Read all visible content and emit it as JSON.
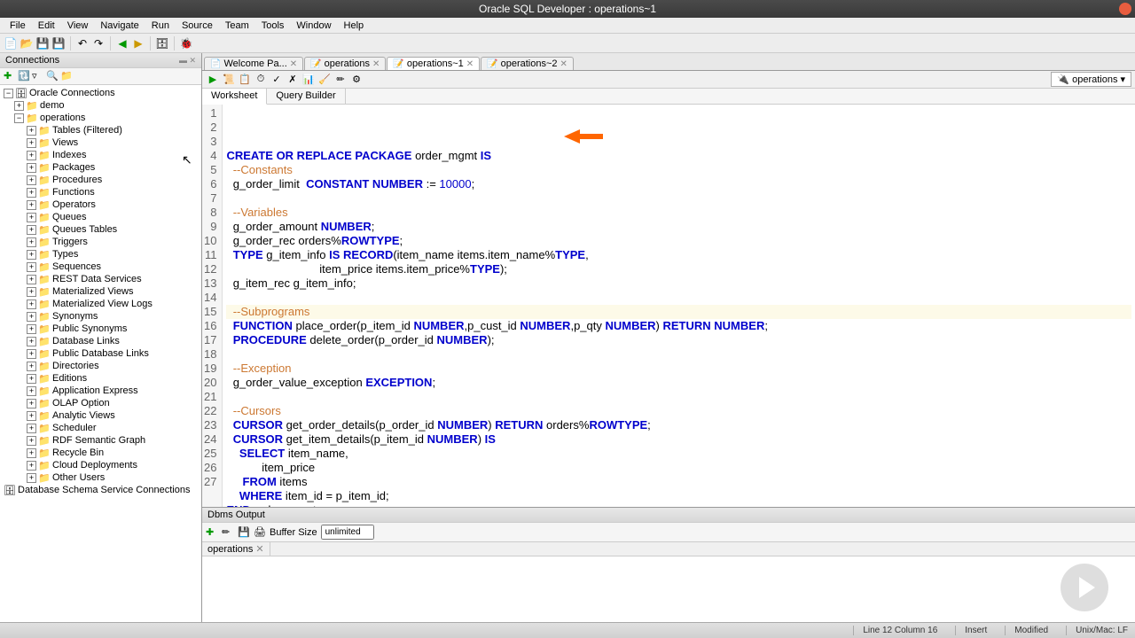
{
  "titlebar": {
    "text": "Oracle SQL Developer : operations~1"
  },
  "menubar": [
    "File",
    "Edit",
    "View",
    "Navigate",
    "Run",
    "Source",
    "Team",
    "Tools",
    "Window",
    "Help"
  ],
  "sidebar": {
    "title": "Connections",
    "root": "Oracle Connections",
    "nodes": [
      {
        "label": "demo",
        "lvl": 1,
        "exp": "+"
      },
      {
        "label": "operations",
        "lvl": 1,
        "exp": "−"
      },
      {
        "label": "Tables (Filtered)",
        "lvl": 2,
        "exp": "+"
      },
      {
        "label": "Views",
        "lvl": 2,
        "exp": "+"
      },
      {
        "label": "Indexes",
        "lvl": 2,
        "exp": "+"
      },
      {
        "label": "Packages",
        "lvl": 2,
        "exp": "+"
      },
      {
        "label": "Procedures",
        "lvl": 2,
        "exp": "+"
      },
      {
        "label": "Functions",
        "lvl": 2,
        "exp": "+"
      },
      {
        "label": "Operators",
        "lvl": 2,
        "exp": "+"
      },
      {
        "label": "Queues",
        "lvl": 2,
        "exp": "+"
      },
      {
        "label": "Queues Tables",
        "lvl": 2,
        "exp": "+"
      },
      {
        "label": "Triggers",
        "lvl": 2,
        "exp": "+"
      },
      {
        "label": "Types",
        "lvl": 2,
        "exp": "+"
      },
      {
        "label": "Sequences",
        "lvl": 2,
        "exp": "+"
      },
      {
        "label": "REST Data Services",
        "lvl": 2,
        "exp": "+"
      },
      {
        "label": "Materialized Views",
        "lvl": 2,
        "exp": "+"
      },
      {
        "label": "Materialized View Logs",
        "lvl": 2,
        "exp": "+"
      },
      {
        "label": "Synonyms",
        "lvl": 2,
        "exp": "+"
      },
      {
        "label": "Public Synonyms",
        "lvl": 2,
        "exp": "+"
      },
      {
        "label": "Database Links",
        "lvl": 2,
        "exp": "+"
      },
      {
        "label": "Public Database Links",
        "lvl": 2,
        "exp": "+"
      },
      {
        "label": "Directories",
        "lvl": 2,
        "exp": "+"
      },
      {
        "label": "Editions",
        "lvl": 2,
        "exp": "+"
      },
      {
        "label": "Application Express",
        "lvl": 2,
        "exp": "+"
      },
      {
        "label": "OLAP Option",
        "lvl": 2,
        "exp": "+"
      },
      {
        "label": "Analytic Views",
        "lvl": 2,
        "exp": "+"
      },
      {
        "label": "Scheduler",
        "lvl": 2,
        "exp": "+"
      },
      {
        "label": "RDF Semantic Graph",
        "lvl": 2,
        "exp": "+"
      },
      {
        "label": "Recycle Bin",
        "lvl": 2,
        "exp": "+"
      },
      {
        "label": "Cloud Deployments",
        "lvl": 2,
        "exp": "+"
      },
      {
        "label": "Other Users",
        "lvl": 2,
        "exp": "+"
      }
    ],
    "bottom": "Database Schema Service Connections"
  },
  "tabs": [
    {
      "label": "Welcome Pa...",
      "icon": "📄",
      "active": false
    },
    {
      "label": "operations",
      "icon": "📝",
      "active": false
    },
    {
      "label": "operations~1",
      "icon": "📝",
      "active": true
    },
    {
      "label": "operations~2",
      "icon": "📝",
      "active": false
    }
  ],
  "conn_label": "operations",
  "subtabs": {
    "worksheet": "Worksheet",
    "querybuilder": "Query Builder"
  },
  "code_lines": [
    {
      "n": 1,
      "html": "<span class='kw'>CREATE OR REPLACE PACKAGE</span> order_mgmt <span class='kw'>IS</span>"
    },
    {
      "n": 2,
      "html": "  <span class='cm'>--Constants</span>"
    },
    {
      "n": 3,
      "html": "  g_order_limit  <span class='kw'>CONSTANT NUMBER</span> := <span class='num'>10000</span>;"
    },
    {
      "n": 4,
      "html": ""
    },
    {
      "n": 5,
      "html": "  <span class='cm'>--Variables</span>"
    },
    {
      "n": 6,
      "html": "  g_order_amount <span class='kw'>NUMBER</span>;"
    },
    {
      "n": 7,
      "html": "  g_order_rec orders%<span class='kw'>ROWTYPE</span>;"
    },
    {
      "n": 8,
      "html": "  <span class='kw'>TYPE</span> g_item_info <span class='kw'>IS RECORD</span>(item_name items.item_name%<span class='kw'>TYPE</span>,"
    },
    {
      "n": 9,
      "html": "                             item_price items.item_price%<span class='kw'>TYPE</span>);"
    },
    {
      "n": 10,
      "html": "  g_item_rec g_item_info;"
    },
    {
      "n": 11,
      "html": ""
    },
    {
      "n": 12,
      "html": "  <span class='cm'>--Subprograms</span>",
      "hl": true
    },
    {
      "n": 13,
      "html": "  <span class='kw'>FUNCTION</span> place_order(p_item_id <span class='kw'>NUMBER</span>,p_cust_id <span class='kw'>NUMBER</span>,p_qty <span class='kw'>NUMBER</span>) <span class='kw'>RETURN NUMBER</span>;"
    },
    {
      "n": 14,
      "html": "  <span class='kw'>PROCEDURE</span> delete_order(p_order_id <span class='kw'>NUMBER</span>);"
    },
    {
      "n": 15,
      "html": ""
    },
    {
      "n": 16,
      "html": "  <span class='cm'>--Exception</span>"
    },
    {
      "n": 17,
      "html": "  g_order_value_exception <span class='kw'>EXCEPTION</span>;"
    },
    {
      "n": 18,
      "html": ""
    },
    {
      "n": 19,
      "html": "  <span class='cm'>--Cursors</span>"
    },
    {
      "n": 20,
      "html": "  <span class='kw'>CURSOR</span> get_order_details(p_order_id <span class='kw'>NUMBER</span>) <span class='kw'>RETURN</span> orders%<span class='kw'>ROWTYPE</span>;"
    },
    {
      "n": 21,
      "html": "  <span class='kw'>CURSOR</span> get_item_details(p_item_id <span class='kw'>NUMBER</span>) <span class='kw'>IS</span>"
    },
    {
      "n": 22,
      "html": "    <span class='kw'>SELECT</span> item_name,"
    },
    {
      "n": 23,
      "html": "           item_price"
    },
    {
      "n": 24,
      "html": "     <span class='kw'>FROM</span> items"
    },
    {
      "n": 25,
      "html": "    <span class='kw'>WHERE</span> item_id = p_item_id;"
    },
    {
      "n": 26,
      "html": "<span class='kw'>END</span> order_mgmt;"
    },
    {
      "n": 27,
      "html": "/"
    }
  ],
  "output": {
    "title": "Dbms Output",
    "buffer_label": "Buffer Size",
    "buffer_value": "unlimited",
    "tab": "operations"
  },
  "statusbar": {
    "pos": "Line 12 Column 16",
    "mode": "Insert",
    "mod": "Modified",
    "enc": "Unix/Mac: LF"
  }
}
